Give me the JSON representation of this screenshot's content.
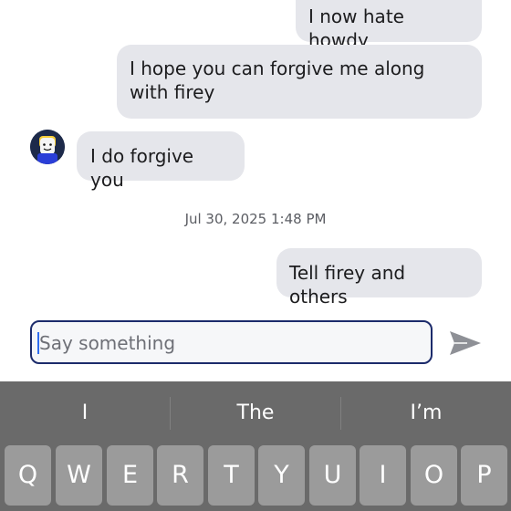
{
  "messages": [
    {
      "side": "right",
      "text": "I now hate howdy"
    },
    {
      "side": "right",
      "text": "I hope you can forgive me along with firey"
    },
    {
      "side": "left",
      "text": "I do forgive you"
    },
    {
      "side": "right",
      "text": "Tell firey and others"
    }
  ],
  "timestamp": "Jul 30, 2025 1:48 PM",
  "composer": {
    "placeholder": "Say something",
    "send_icon": "send-icon"
  },
  "keyboard": {
    "suggestions": [
      "I",
      "The",
      "I’m"
    ],
    "row1": [
      "Q",
      "W",
      "E",
      "R",
      "T",
      "Y",
      "U",
      "I",
      "O",
      "P"
    ]
  }
}
